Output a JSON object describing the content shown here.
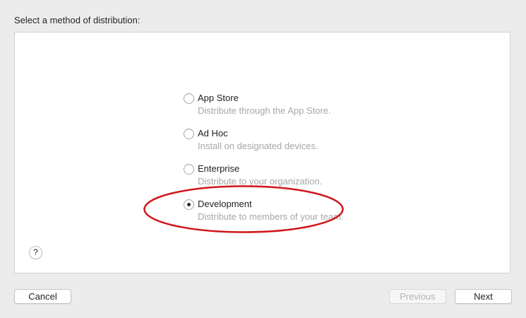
{
  "heading": "Select a method of distribution:",
  "options": [
    {
      "label": "App Store",
      "description": "Distribute through the App Store.",
      "selected": false
    },
    {
      "label": "Ad Hoc",
      "description": "Install on designated devices.",
      "selected": false
    },
    {
      "label": "Enterprise",
      "description": "Distribute to your organization.",
      "selected": false
    },
    {
      "label": "Development",
      "description": "Distribute to members of your team.",
      "selected": true
    }
  ],
  "help": {
    "label": "?"
  },
  "buttons": {
    "cancel": "Cancel",
    "previous": "Previous",
    "next": "Next"
  },
  "annotation": {
    "shape": "ellipse",
    "color": "#d0161b",
    "target": "Development"
  }
}
